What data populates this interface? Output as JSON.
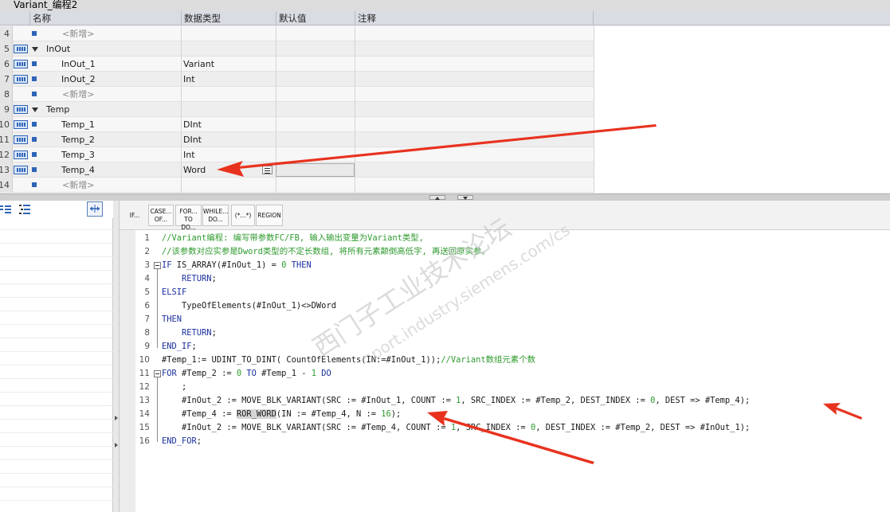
{
  "title": "Variant_编程2",
  "table": {
    "headers": {
      "name": "名称",
      "datatype": "数据类型",
      "default": "默认值",
      "comment": "注释"
    },
    "rows": [
      {
        "num": "4",
        "kind": "add",
        "name": "<新增>",
        "datatype": ""
      },
      {
        "num": "5",
        "kind": "section",
        "name": "InOut",
        "datatype": ""
      },
      {
        "num": "6",
        "kind": "var",
        "name": "InOut_1",
        "datatype": "Variant"
      },
      {
        "num": "7",
        "kind": "var",
        "name": "InOut_2",
        "datatype": "Int"
      },
      {
        "num": "8",
        "kind": "add",
        "name": "<新增>",
        "datatype": ""
      },
      {
        "num": "9",
        "kind": "section",
        "name": "Temp",
        "datatype": ""
      },
      {
        "num": "10",
        "kind": "var",
        "name": "Temp_1",
        "datatype": "DInt"
      },
      {
        "num": "11",
        "kind": "var",
        "name": "Temp_2",
        "datatype": "DInt"
      },
      {
        "num": "12",
        "kind": "var",
        "name": "Temp_3",
        "datatype": "Int"
      },
      {
        "num": "13",
        "kind": "var",
        "name": "Temp_4",
        "datatype": "Word"
      },
      {
        "num": "14",
        "kind": "add",
        "name": "<新增>",
        "datatype": ""
      }
    ]
  },
  "toolbar": {
    "if": "IF...",
    "case_1": "CASE...",
    "case_2": "OF...",
    "for_1": "FOR...",
    "for_2": "TO DO...",
    "while_1": "WHILE...",
    "while_2": "DO...",
    "comment": "(*...*)",
    "region": "REGION"
  },
  "code": [
    {
      "n": "1",
      "fold": false,
      "text": "//Variant编程: 编写带参数FC/FB, 输入输出变量为Variant类型,"
    },
    {
      "n": "2",
      "fold": false,
      "text": "//该参数对应实参是Dword类型的不定长数组, 将所有元素颠倒高低字, 再送回原实参。"
    },
    {
      "n": "3",
      "fold": true,
      "text": "IF IS_ARRAY(#InOut_1) = 0 THEN"
    },
    {
      "n": "4",
      "fold": false,
      "text": "    RETURN;"
    },
    {
      "n": "5",
      "fold": false,
      "text": "ELSIF"
    },
    {
      "n": "6",
      "fold": false,
      "text": "    TypeOfElements(#InOut_1)<>DWord"
    },
    {
      "n": "7",
      "fold": false,
      "text": "THEN"
    },
    {
      "n": "8",
      "fold": false,
      "text": "    RETURN;"
    },
    {
      "n": "9",
      "fold": false,
      "text": "END_IF;"
    },
    {
      "n": "10",
      "fold": false,
      "text": "#Temp_1:= UDINT_TO_DINT( CountOfElements(IN:=#InOut_1));//Variant数组元素个数"
    },
    {
      "n": "11",
      "fold": true,
      "text": "FOR #Temp_2 := 0 TO #Temp_1 - 1 DO"
    },
    {
      "n": "12",
      "fold": false,
      "text": "    ;"
    },
    {
      "n": "13",
      "fold": false,
      "text": "    #InOut_2 := MOVE_BLK_VARIANT(SRC := #InOut_1, COUNT := 1, SRC_INDEX := #Temp_2, DEST_INDEX := 0, DEST => #Temp_4);"
    },
    {
      "n": "14",
      "fold": false,
      "pre": "    #Temp_4 := ",
      "hl": "ROR_WORD",
      "post": "(IN := #Temp_4, N := 16);"
    },
    {
      "n": "15",
      "fold": false,
      "text": "    #InOut_2 := MOVE_BLK_VARIANT(SRC := #Temp_4, COUNT := 1, SRC_INDEX := 0, DEST_INDEX := #Temp_2, DEST => #InOut_1);"
    },
    {
      "n": "16",
      "fold": false,
      "text": "END_FOR;"
    }
  ],
  "watermark": {
    "line1": "西门子工业技术论坛",
    "line2": "support.industry.siemens.com/cs"
  },
  "colors": {
    "comment": "#2e9a2e",
    "keyword": "#1b2f9e",
    "number": "#2e9a2e",
    "arrow": "#e8321e",
    "icon_blue": "#2e64b8"
  },
  "icons": [
    "interface-inout-icon",
    "dropdown-icon",
    "collapse-triangle-icon",
    "expand-icon",
    "outdent-icon",
    "list-icon",
    "splitter-arrow-icon"
  ]
}
